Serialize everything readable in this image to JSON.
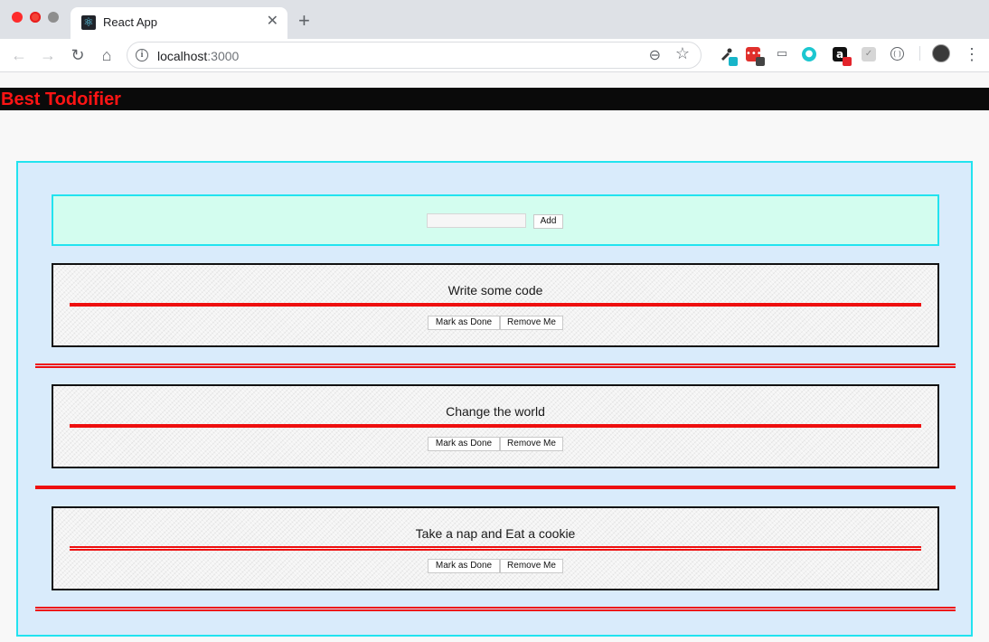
{
  "browser": {
    "tab_title": "React App",
    "tab_close": "✕",
    "new_tab": "+",
    "url_host": "localhost",
    "url_port": ":3000",
    "icons": {
      "back": "←",
      "forward": "→",
      "reload": "↻",
      "home": "⌂",
      "info": "i",
      "zoom": "⊖",
      "star": "☆",
      "menu": "⋮"
    }
  },
  "app": {
    "title": "Best Todoifier",
    "title_color": "#ff1414",
    "input_placeholder": "",
    "add_label": "Add",
    "done_label": "Mark as Done",
    "remove_label": "Remove Me",
    "todos": [
      {
        "text": "Write some code"
      },
      {
        "text": "Change the world"
      },
      {
        "text": "Take a nap and Eat a cookie"
      }
    ]
  },
  "colors": {
    "accent_border": "#22e3ef",
    "board_bg": "#d9ebfb",
    "add_panel_bg": "#d3fdef",
    "rule_red": "#ee0f0f"
  }
}
